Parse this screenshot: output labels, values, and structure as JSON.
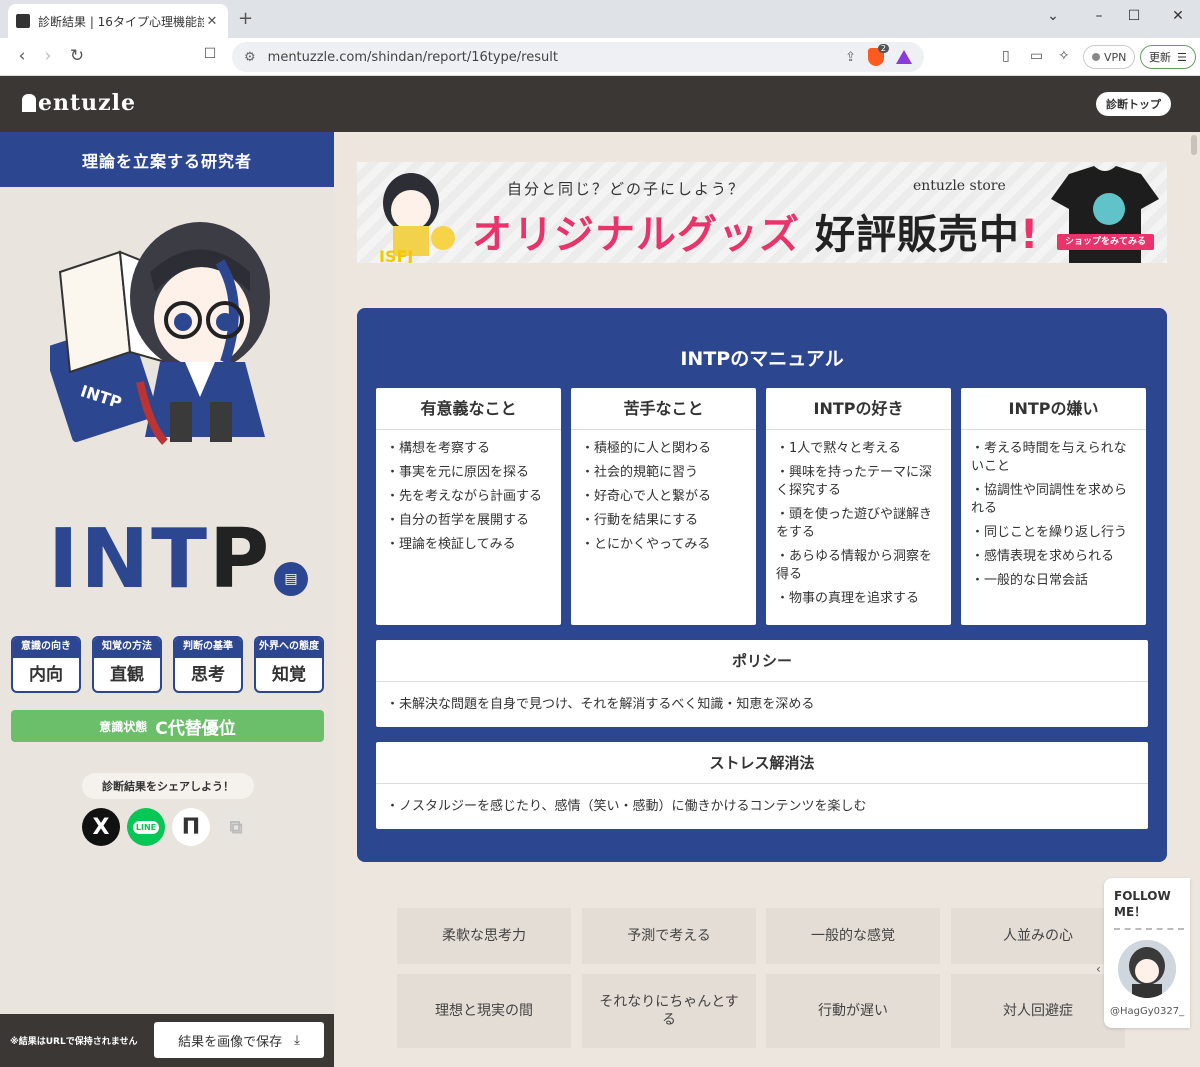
{
  "browser": {
    "tab_title": "診断結果 | 16タイプ心理機能診断",
    "tab_close": "✕",
    "new_tab": "+",
    "url": "mentuzzle.com/shindan/report/16type/result",
    "shield_count": "2",
    "vpn_label": "VPN",
    "update_label": "更新"
  },
  "site": {
    "logo": "entuzle",
    "top_button": "診断トップ"
  },
  "sidebar": {
    "title": "理論を立案する研究者",
    "type": "INTP",
    "type_main": "INT",
    "type_last": "P",
    "book_label": "INTP",
    "functions": [
      {
        "title": "意識の向き",
        "value": "内向"
      },
      {
        "title": "知覚の方法",
        "value": "直観"
      },
      {
        "title": "判断の基準",
        "value": "思考"
      },
      {
        "title": "外界への態度",
        "value": "知覚"
      }
    ],
    "state_label": "意識状態",
    "state_value": "C代替優位",
    "share_label": "診断結果をシェアしよう！",
    "share_x": "X",
    "share_line": "LINE",
    "save_note": "※結果はURLで保持されません",
    "save_button": "結果を画像で保存"
  },
  "banner": {
    "sub": "自分と同じ？どの子にしよう？",
    "main_pink": "オリジナルグッズ",
    "main_dark": "好評販売中",
    "excl": "!",
    "store": "entuzle store",
    "chibi_label": "ISFJ",
    "cta": "ショップをみてみる"
  },
  "manual": {
    "title": "INTPのマニュアル",
    "cards": [
      {
        "title": "有意義なこと",
        "items": [
          "構想を考察する",
          "事実を元に原因を探る",
          "先を考えながら計画する",
          "自分の哲学を展開する",
          "理論を検証してみる"
        ]
      },
      {
        "title": "苦手なこと",
        "items": [
          "積極的に人と関わる",
          "社会的規範に習う",
          "好奇心で人と繋がる",
          "行動を結果にする",
          "とにかくやってみる"
        ]
      },
      {
        "title": "INTPの好き",
        "items": [
          "1人で黙々と考える",
          "興味を持ったテーマに深く探究する",
          "頭を使った遊びや謎解きをする",
          "あらゆる情報から洞察を得る",
          "物事の真理を追求する"
        ]
      },
      {
        "title": "INTPの嫌い",
        "items": [
          "考える時間を与えられないこと",
          "協調性や同調性を求められる",
          "同じことを繰り返し行う",
          "感情表現を求められる",
          "一般的な日常会話"
        ]
      }
    ],
    "policy_title": "ポリシー",
    "policy_text": "未解決な問題を自身で見つけ、それを解消するべく知識・知恵を深める",
    "stress_title": "ストレス解消法",
    "stress_text": "ノスタルジーを感じたり、感情（笑い・感動）に働きかけるコンテンツを楽しむ"
  },
  "traits": [
    "柔軟な思考力",
    "予測で考える",
    "一般的な感覚",
    "人並みの心",
    "理想と現実の間",
    "それなりにちゃんとする",
    "行動が遅い",
    "対人回避症"
  ],
  "follow": {
    "label_line1": "FOLLOW",
    "label_line2": "ME！",
    "handle": "@HagGy0327_"
  },
  "colors": {
    "brand_navy": "#2c4690",
    "header_dark": "#3a3734",
    "state_green": "#6bbf6b",
    "banner_pink": "#e8336b"
  }
}
